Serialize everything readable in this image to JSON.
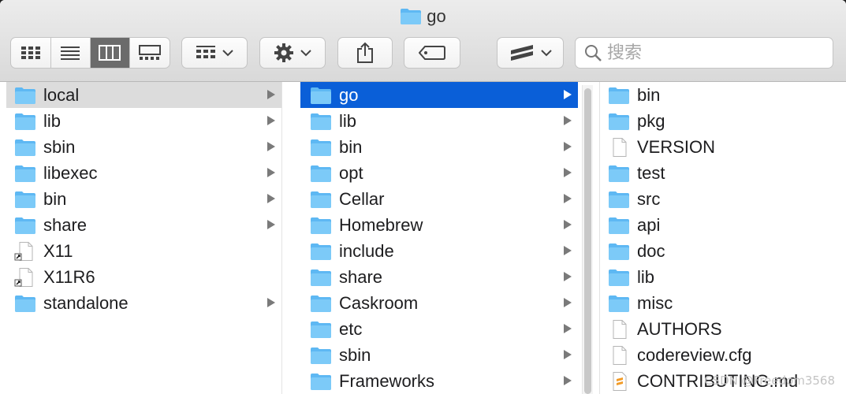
{
  "window": {
    "title": "go"
  },
  "toolbar": {
    "view_modes": [
      {
        "name": "icon-view",
        "icon": "grid-icon",
        "active": false
      },
      {
        "name": "list-view",
        "icon": "list-icon",
        "active": false
      },
      {
        "name": "column-view",
        "icon": "columns-icon",
        "active": true
      },
      {
        "name": "gallery-view",
        "icon": "gallery-icon",
        "active": false
      }
    ],
    "buttons": [
      "group-by",
      "action-gear",
      "share",
      "tag",
      "sublime-text"
    ]
  },
  "search": {
    "placeholder": "搜索"
  },
  "columns": [
    {
      "items": [
        {
          "label": "local",
          "kind": "folder",
          "has_children": true,
          "selected": "gray"
        },
        {
          "label": "lib",
          "kind": "folder",
          "has_children": true
        },
        {
          "label": "sbin",
          "kind": "folder",
          "has_children": true
        },
        {
          "label": "libexec",
          "kind": "folder",
          "has_children": true
        },
        {
          "label": "bin",
          "kind": "folder",
          "has_children": true
        },
        {
          "label": "share",
          "kind": "folder",
          "has_children": true
        },
        {
          "label": "X11",
          "kind": "alias",
          "has_children": false
        },
        {
          "label": "X11R6",
          "kind": "alias",
          "has_children": false
        },
        {
          "label": "standalone",
          "kind": "folder",
          "has_children": true
        }
      ]
    },
    {
      "items": [
        {
          "label": "go",
          "kind": "folder",
          "has_children": true,
          "selected": "blue"
        },
        {
          "label": "lib",
          "kind": "folder",
          "has_children": true
        },
        {
          "label": "bin",
          "kind": "folder",
          "has_children": true
        },
        {
          "label": "opt",
          "kind": "folder",
          "has_children": true
        },
        {
          "label": "Cellar",
          "kind": "folder",
          "has_children": true
        },
        {
          "label": "Homebrew",
          "kind": "folder",
          "has_children": true
        },
        {
          "label": "include",
          "kind": "folder",
          "has_children": true
        },
        {
          "label": "share",
          "kind": "folder",
          "has_children": true
        },
        {
          "label": "Caskroom",
          "kind": "folder",
          "has_children": true
        },
        {
          "label": "etc",
          "kind": "folder",
          "has_children": true
        },
        {
          "label": "sbin",
          "kind": "folder",
          "has_children": true
        },
        {
          "label": "Frameworks",
          "kind": "folder",
          "has_children": true
        }
      ]
    },
    {
      "items": [
        {
          "label": "bin",
          "kind": "folder"
        },
        {
          "label": "pkg",
          "kind": "folder"
        },
        {
          "label": "VERSION",
          "kind": "file"
        },
        {
          "label": "test",
          "kind": "folder"
        },
        {
          "label": "src",
          "kind": "folder"
        },
        {
          "label": "api",
          "kind": "folder"
        },
        {
          "label": "doc",
          "kind": "folder"
        },
        {
          "label": "lib",
          "kind": "folder"
        },
        {
          "label": "misc",
          "kind": "folder"
        },
        {
          "label": "AUTHORS",
          "kind": "file"
        },
        {
          "label": "codereview.cfg",
          "kind": "file"
        },
        {
          "label": "CONTRIBUTING.md",
          "kind": "markdown"
        }
      ]
    }
  ],
  "watermark": "CSDN @Freedom3568",
  "colors": {
    "selection_blue": "#0a5fd8",
    "selection_gray": "#dcdcdc",
    "folder": "#5eb8f3"
  }
}
